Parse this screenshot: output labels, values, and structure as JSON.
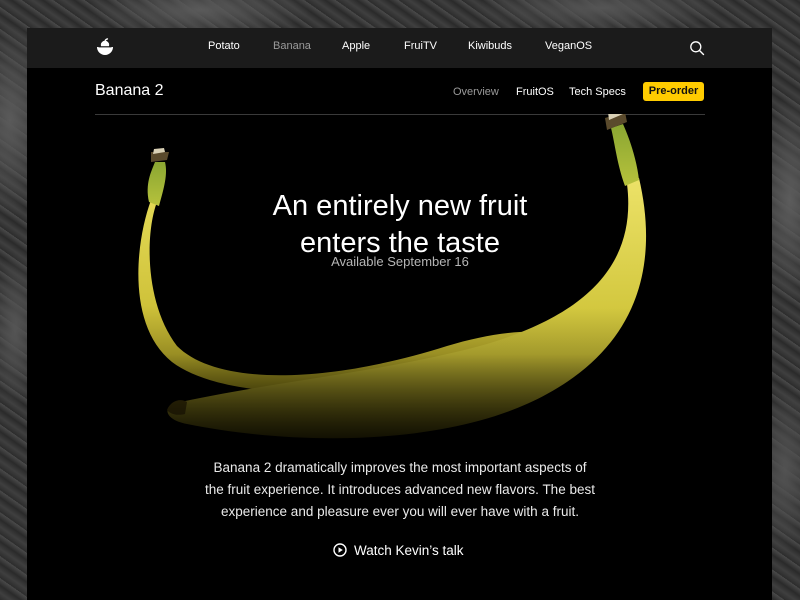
{
  "globalnav": {
    "logo_icon": "fruit-bowl-logo-icon",
    "items": [
      {
        "label": "Potato"
      },
      {
        "label": "Banana",
        "active": true
      },
      {
        "label": "Apple"
      },
      {
        "label": "FruiTV"
      },
      {
        "label": "Kiwibuds"
      },
      {
        "label": "VeganOS"
      }
    ],
    "search_icon": "search-icon"
  },
  "subnav": {
    "title": "Banana 2",
    "items": [
      {
        "label": "Overview",
        "muted": true
      },
      {
        "label": "FruitOS"
      },
      {
        "label": "Tech Specs"
      }
    ],
    "cta": "Pre-order",
    "cta_color": "#ffcc00"
  },
  "hero": {
    "headline_line1": "An entirely new fruit",
    "headline_line2": "enters the taste",
    "availability": "Available September 16",
    "description_lines": [
      "Banana 2 dramatically improves the most important aspects of",
      "the fruit experience. It introduces advanced new flavors. The best",
      "experience and pleasure ever you will ever have with a fruit."
    ],
    "watch_icon": "play-circle-icon",
    "watch_label": "Watch Kevin’s talk"
  },
  "colors": {
    "background": "#000000",
    "nav_bar": "#1b1b1b",
    "accent": "#ffcc00",
    "banana": "#d9cf45"
  }
}
